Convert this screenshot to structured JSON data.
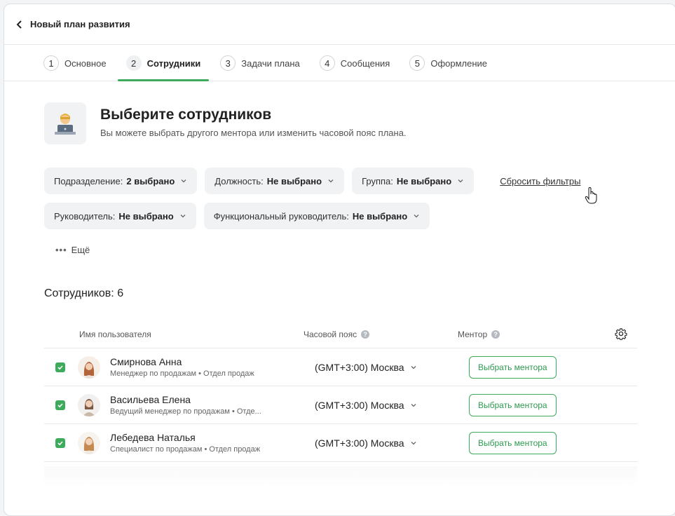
{
  "header": {
    "title": "Новый план развития"
  },
  "steps": [
    {
      "num": "1",
      "label": "Основное"
    },
    {
      "num": "2",
      "label": "Сотрудники"
    },
    {
      "num": "3",
      "label": "Задачи плана"
    },
    {
      "num": "4",
      "label": "Сообщения"
    },
    {
      "num": "5",
      "label": "Оформление"
    }
  ],
  "active_step": 2,
  "hero": {
    "title": "Выберите сотрудников",
    "subtitle": "Вы можете выбрать другого ментора или изменить часовой пояс плана."
  },
  "filters": {
    "department": {
      "label": "Подразделение:",
      "value": "2 выбрано"
    },
    "position": {
      "label": "Должность:",
      "value": "Не выбрано"
    },
    "group": {
      "label": "Группа:",
      "value": "Не выбрано"
    },
    "manager": {
      "label": "Руководитель:",
      "value": "Не выбрано"
    },
    "functional_manager": {
      "label": "Функциональный руководитель:",
      "value": "Не выбрано"
    },
    "reset_label": "Сбросить фильтры",
    "more_label": "Ещё"
  },
  "count_label": "Сотрудников: 6",
  "table": {
    "headers": {
      "name": "Имя пользователя",
      "timezone": "Часовой пояс",
      "mentor": "Ментор"
    },
    "rows": [
      {
        "name": "Смирнова Анна",
        "role": "Менеджер по продажам • Отдел продаж",
        "timezone": "(GMT+3:00) Москва",
        "mentor_button": "Выбрать ментора",
        "checked": true
      },
      {
        "name": "Васильева Елена",
        "role": "Ведущий менеджер по продажам • Отде...",
        "timezone": "(GMT+3:00) Москва",
        "mentor_button": "Выбрать ментора",
        "checked": true
      },
      {
        "name": "Лебедева Наталья",
        "role": "Специалист по продажам • Отдел продаж",
        "timezone": "(GMT+3:00) Москва",
        "mentor_button": "Выбрать ментора",
        "checked": true
      }
    ]
  },
  "colors": {
    "accent": "#3daa5c",
    "chip_bg": "#f1f2f4"
  },
  "icons": {
    "back": "chevron-left-icon",
    "settings": "gear-icon",
    "help": "question-icon",
    "checkbox": "check-icon"
  }
}
